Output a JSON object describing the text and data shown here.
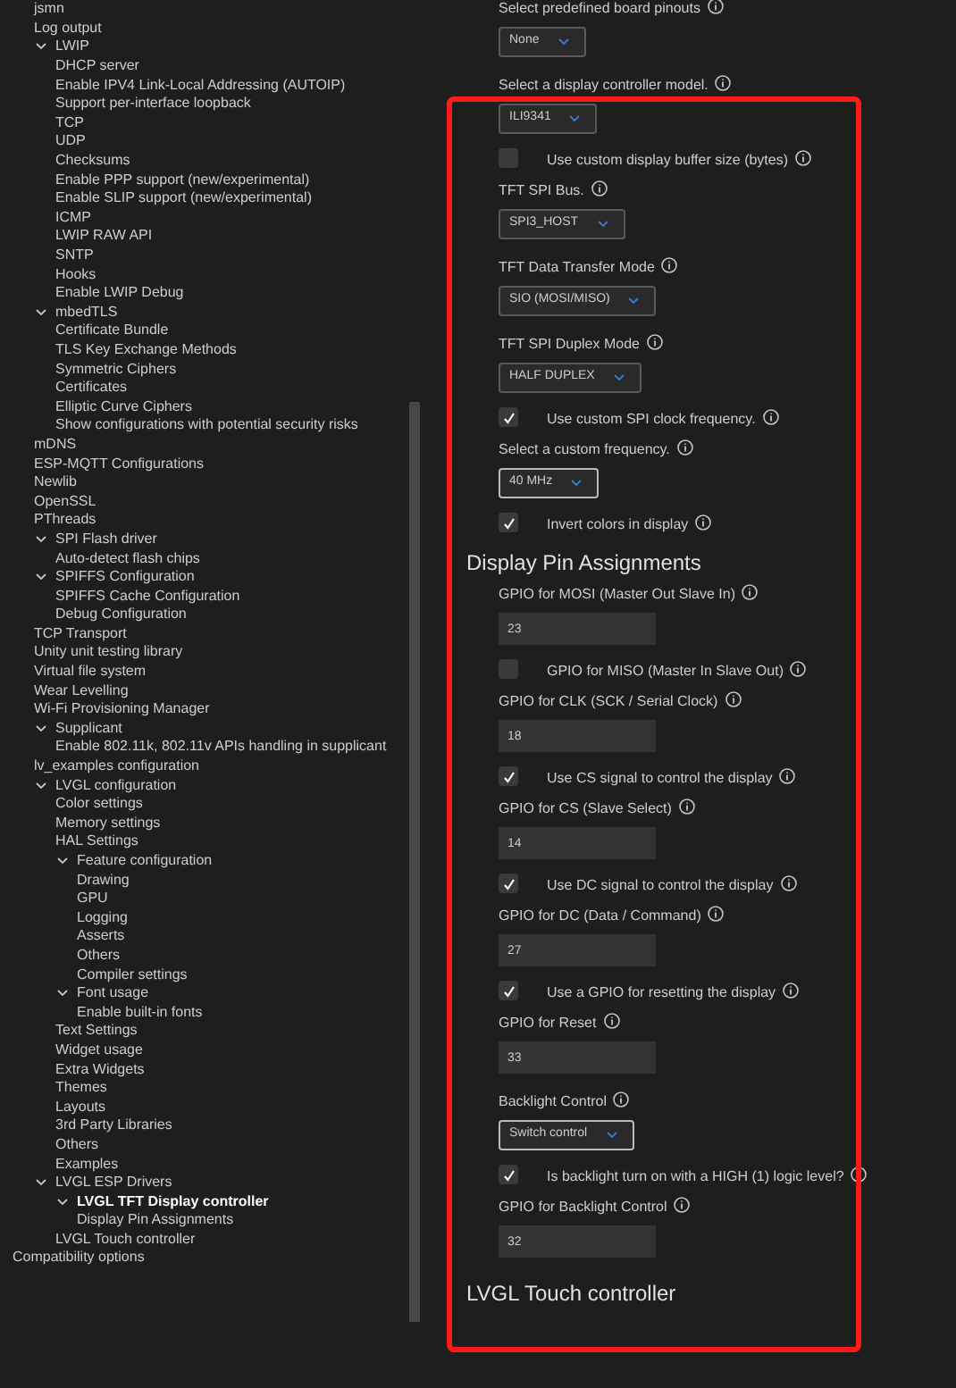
{
  "tree": {
    "items": [
      {
        "label": "jsmn"
      },
      {
        "label": "Log output"
      },
      {
        "label": "LWIP",
        "expanded": true,
        "children": [
          {
            "label": "DHCP server"
          },
          {
            "label": "Enable IPV4 Link-Local Addressing (AUTOIP)"
          },
          {
            "label": "Support per-interface loopback"
          },
          {
            "label": "TCP"
          },
          {
            "label": "UDP"
          },
          {
            "label": "Checksums"
          },
          {
            "label": "Enable PPP support (new/experimental)"
          },
          {
            "label": "Enable SLIP support (new/experimental)"
          },
          {
            "label": "ICMP"
          },
          {
            "label": "LWIP RAW API"
          },
          {
            "label": "SNTP"
          },
          {
            "label": "Hooks"
          },
          {
            "label": "Enable LWIP Debug"
          }
        ]
      },
      {
        "label": "mbedTLS",
        "expanded": true,
        "children": [
          {
            "label": "Certificate Bundle"
          },
          {
            "label": "TLS Key Exchange Methods"
          },
          {
            "label": "Symmetric Ciphers"
          },
          {
            "label": "Certificates"
          },
          {
            "label": "Elliptic Curve Ciphers"
          },
          {
            "label": "Show configurations with potential security risks"
          }
        ]
      },
      {
        "label": "mDNS"
      },
      {
        "label": "ESP-MQTT Configurations"
      },
      {
        "label": "Newlib"
      },
      {
        "label": "OpenSSL"
      },
      {
        "label": "PThreads"
      },
      {
        "label": "SPI Flash driver",
        "expanded": true,
        "children": [
          {
            "label": "Auto-detect flash chips"
          }
        ]
      },
      {
        "label": "SPIFFS Configuration",
        "expanded": true,
        "children": [
          {
            "label": "SPIFFS Cache Configuration"
          },
          {
            "label": "Debug Configuration"
          }
        ]
      },
      {
        "label": "TCP Transport"
      },
      {
        "label": "Unity unit testing library"
      },
      {
        "label": "Virtual file system"
      },
      {
        "label": "Wear Levelling"
      },
      {
        "label": "Wi-Fi Provisioning Manager"
      },
      {
        "label": "Supplicant",
        "expanded": true,
        "children": [
          {
            "label": "Enable 802.11k, 802.11v APIs handling in supplicant"
          }
        ]
      },
      {
        "label": "lv_examples configuration"
      },
      {
        "label": "LVGL configuration",
        "expanded": true,
        "children": [
          {
            "label": "Color settings"
          },
          {
            "label": "Memory settings"
          },
          {
            "label": "HAL Settings"
          },
          {
            "label": "Feature configuration",
            "expanded": true,
            "children": [
              {
                "label": "Drawing"
              },
              {
                "label": "GPU"
              },
              {
                "label": "Logging"
              },
              {
                "label": "Asserts"
              },
              {
                "label": "Others"
              },
              {
                "label": "Compiler settings"
              }
            ]
          },
          {
            "label": "Font usage",
            "expanded": true,
            "children": [
              {
                "label": "Enable built-in fonts"
              }
            ]
          },
          {
            "label": "Text Settings"
          },
          {
            "label": "Widget usage"
          },
          {
            "label": "Extra Widgets"
          },
          {
            "label": "Themes"
          },
          {
            "label": "Layouts"
          },
          {
            "label": "3rd Party Libraries"
          },
          {
            "label": "Others"
          },
          {
            "label": "Examples"
          }
        ]
      },
      {
        "label": "LVGL ESP Drivers",
        "expanded": true,
        "children": [
          {
            "label": "LVGL TFT Display controller",
            "selected": true,
            "expanded": true,
            "children": [
              {
                "label": "Display Pin Assignments"
              }
            ]
          },
          {
            "label": "LVGL Touch controller"
          }
        ]
      }
    ],
    "root_items": [
      {
        "label": "Compatibility options"
      }
    ]
  },
  "settings": [
    {
      "kind": "label",
      "text": "Select predefined board pinouts"
    },
    {
      "kind": "dropdown",
      "value": "None",
      "focused": false
    },
    {
      "kind": "label",
      "text": "Select a display controller model."
    },
    {
      "kind": "dropdown",
      "value": "ILI9341",
      "focused": false
    },
    {
      "kind": "checkbox",
      "text": "Use custom display buffer size (bytes)",
      "checked": false
    },
    {
      "kind": "label",
      "text": "TFT SPI Bus."
    },
    {
      "kind": "dropdown",
      "value": "SPI3_HOST",
      "focused": false
    },
    {
      "kind": "label",
      "text": "TFT Data Transfer Mode"
    },
    {
      "kind": "dropdown",
      "value": "SIO (MOSI/MISO)",
      "focused": false
    },
    {
      "kind": "label",
      "text": "TFT SPI Duplex Mode"
    },
    {
      "kind": "dropdown",
      "value": "HALF DUPLEX",
      "focused": false
    },
    {
      "kind": "checkbox",
      "text": "Use custom SPI clock frequency.",
      "checked": true
    },
    {
      "kind": "label",
      "text": "Select a custom frequency."
    },
    {
      "kind": "dropdown",
      "value": "40 MHz",
      "focused": true
    },
    {
      "kind": "checkbox",
      "text": "Invert colors in display",
      "checked": true
    },
    {
      "kind": "heading",
      "text": "Display Pin Assignments"
    },
    {
      "kind": "label",
      "text": "GPIO for MOSI (Master Out Slave In)"
    },
    {
      "kind": "input",
      "value": "23"
    },
    {
      "kind": "checkbox",
      "text": "GPIO for MISO (Master In Slave Out)",
      "checked": false
    },
    {
      "kind": "label",
      "text": "GPIO for CLK (SCK / Serial Clock)"
    },
    {
      "kind": "input",
      "value": "18"
    },
    {
      "kind": "checkbox",
      "text": "Use CS signal to control the display",
      "checked": true
    },
    {
      "kind": "label",
      "text": "GPIO for CS (Slave Select)"
    },
    {
      "kind": "input",
      "value": "14"
    },
    {
      "kind": "checkbox",
      "text": "Use DC signal to control the display",
      "checked": true
    },
    {
      "kind": "label",
      "text": "GPIO for DC (Data / Command)"
    },
    {
      "kind": "input",
      "value": "27"
    },
    {
      "kind": "checkbox",
      "text": "Use a GPIO for resetting the display",
      "checked": true
    },
    {
      "kind": "label",
      "text": "GPIO for Reset"
    },
    {
      "kind": "input",
      "value": "33"
    },
    {
      "kind": "label",
      "text": "Backlight Control"
    },
    {
      "kind": "dropdown",
      "value": "Switch control",
      "focused": true
    },
    {
      "kind": "checkbox",
      "text": "Is backlight turn on with a HIGH (1) logic level?",
      "checked": true
    },
    {
      "kind": "label",
      "text": "GPIO for Backlight Control"
    },
    {
      "kind": "input",
      "value": "32"
    },
    {
      "kind": "heading",
      "text": "LVGL Touch controller"
    }
  ]
}
